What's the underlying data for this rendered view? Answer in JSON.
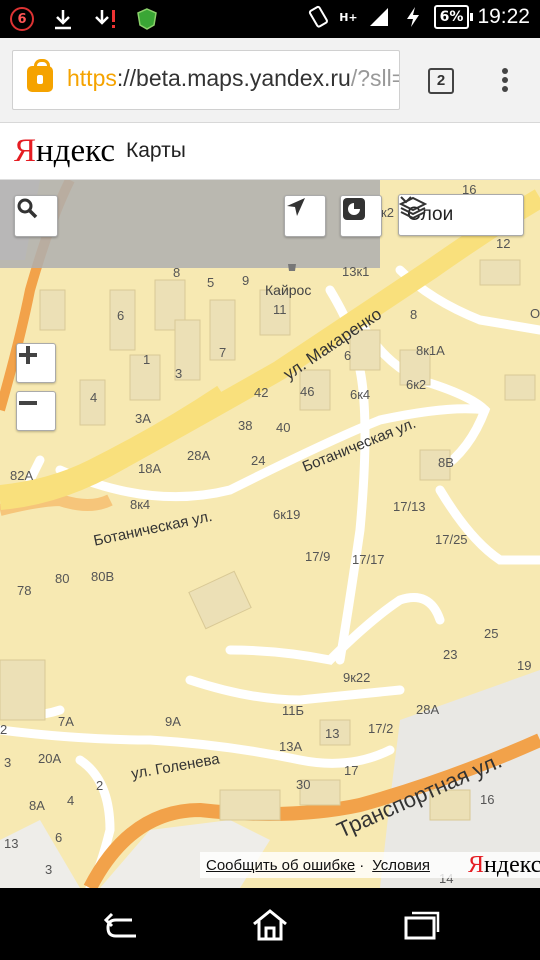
{
  "status_bar": {
    "notification_count": "6",
    "network": "H+",
    "battery": "6%",
    "time": "19:22"
  },
  "browser": {
    "url_scheme": "https",
    "url_host": "://beta.maps.yandex.ru",
    "url_rest": "/?sll=",
    "tab_count": "2"
  },
  "header": {
    "logo_first": "Я",
    "logo_rest": "ндекс",
    "service": "Карты"
  },
  "map": {
    "layers_label": "Слои",
    "streets": {
      "makarenko": "ул. Макаренко",
      "botanicheskaya_1": "Ботаническая ул.",
      "botanicheskaya_2": "Ботаническая ул.",
      "golenyova": "ул. Голенева",
      "transportnaya": "Транспортная ул."
    },
    "poi": "Кайрос",
    "house_numbers": [
      {
        "id": "h1",
        "t": "8"
      },
      {
        "id": "h2",
        "t": "5"
      },
      {
        "id": "h3",
        "t": "9"
      },
      {
        "id": "h4",
        "t": "6"
      },
      {
        "id": "h5",
        "t": "11"
      },
      {
        "id": "h6",
        "t": "13к1"
      },
      {
        "id": "h7",
        "t": "к2"
      },
      {
        "id": "h8",
        "t": "16"
      },
      {
        "id": "h9",
        "t": "12"
      },
      {
        "id": "h10",
        "t": "8"
      },
      {
        "id": "h11",
        "t": "О"
      },
      {
        "id": "h12",
        "t": "1"
      },
      {
        "id": "h13",
        "t": "7"
      },
      {
        "id": "h14",
        "t": "3"
      },
      {
        "id": "h15",
        "t": "6"
      },
      {
        "id": "h16",
        "t": "8к1А"
      },
      {
        "id": "h17",
        "t": "4"
      },
      {
        "id": "h18",
        "t": "46"
      },
      {
        "id": "h19",
        "t": "42"
      },
      {
        "id": "h20",
        "t": "6к4"
      },
      {
        "id": "h21",
        "t": "6к2"
      },
      {
        "id": "h22",
        "t": "3А"
      },
      {
        "id": "h23",
        "t": "38"
      },
      {
        "id": "h24",
        "t": "40"
      },
      {
        "id": "h25",
        "t": "28А"
      },
      {
        "id": "h26",
        "t": "24"
      },
      {
        "id": "h27",
        "t": "18А"
      },
      {
        "id": "h28",
        "t": "82А"
      },
      {
        "id": "h29",
        "t": "8В"
      },
      {
        "id": "h30",
        "t": "8к4"
      },
      {
        "id": "h31",
        "t": "6к19"
      },
      {
        "id": "h32",
        "t": "17/13"
      },
      {
        "id": "h33",
        "t": "17/25"
      },
      {
        "id": "h34",
        "t": "17/9"
      },
      {
        "id": "h35",
        "t": "17/17"
      },
      {
        "id": "h36",
        "t": "80"
      },
      {
        "id": "h37",
        "t": "80В"
      },
      {
        "id": "h38",
        "t": "78"
      },
      {
        "id": "h39",
        "t": "25"
      },
      {
        "id": "h40",
        "t": "23"
      },
      {
        "id": "h41",
        "t": "19"
      },
      {
        "id": "h42",
        "t": "9к22"
      },
      {
        "id": "h43",
        "t": "28А"
      },
      {
        "id": "h44",
        "t": "7А"
      },
      {
        "id": "h45",
        "t": "9А"
      },
      {
        "id": "h46",
        "t": "11Б"
      },
      {
        "id": "h47",
        "t": "13"
      },
      {
        "id": "h48",
        "t": "17/2"
      },
      {
        "id": "h49",
        "t": "13А"
      },
      {
        "id": "h50",
        "t": "20А"
      },
      {
        "id": "h51",
        "t": "3"
      },
      {
        "id": "h52",
        "t": "2"
      },
      {
        "id": "h53",
        "t": "17"
      },
      {
        "id": "h54",
        "t": "30"
      },
      {
        "id": "h55",
        "t": "8А"
      },
      {
        "id": "h56",
        "t": "4"
      },
      {
        "id": "h57",
        "t": "16"
      },
      {
        "id": "h58",
        "t": "13"
      },
      {
        "id": "h59",
        "t": "6"
      },
      {
        "id": "h60",
        "t": "3"
      },
      {
        "id": "h61",
        "t": "14"
      },
      {
        "id": "h62",
        "t": "2"
      }
    ],
    "footer": {
      "report_error": "Сообщить об ошибке",
      "separator": "·",
      "terms": "Условия",
      "logo_first": "Я",
      "logo_rest": "ндекс"
    }
  }
}
